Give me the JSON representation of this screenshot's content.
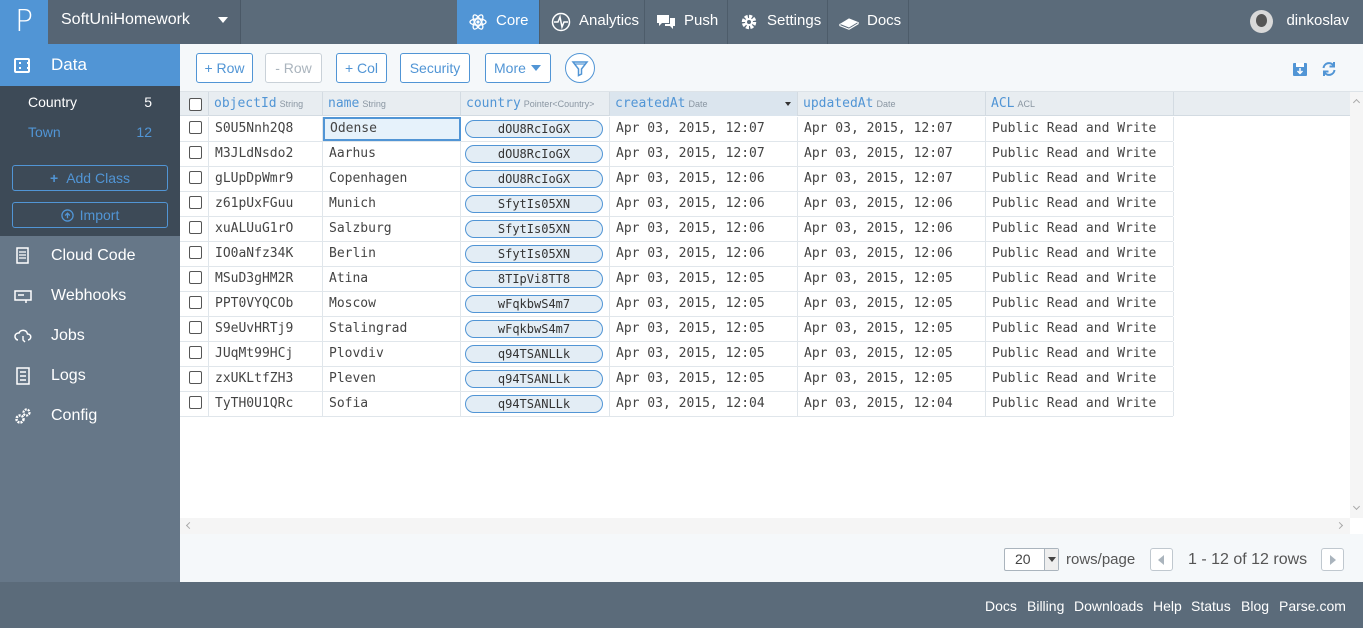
{
  "app": {
    "name": "SoftUniHomework",
    "logo": "P"
  },
  "nav": {
    "tabs": [
      {
        "label": "Core",
        "icon": "atom-icon",
        "active": true
      },
      {
        "label": "Analytics",
        "icon": "pulse-icon"
      },
      {
        "label": "Push",
        "icon": "chat-icon"
      },
      {
        "label": "Settings",
        "icon": "gear-icon"
      },
      {
        "label": "Docs",
        "icon": "book-icon"
      }
    ],
    "user": "dinkoslav"
  },
  "sidebar": {
    "data_label": "Data",
    "classes": [
      {
        "name": "Country",
        "count": "5"
      },
      {
        "name": "Town",
        "count": "12",
        "active": true
      }
    ],
    "add_class": "Add Class",
    "import": "Import",
    "links": [
      {
        "label": "Cloud Code",
        "icon": "document-icon"
      },
      {
        "label": "Webhooks",
        "icon": "webhook-icon"
      },
      {
        "label": "Jobs",
        "icon": "cloud-clock-icon"
      },
      {
        "label": "Logs",
        "icon": "log-icon"
      },
      {
        "label": "Config",
        "icon": "gears-icon"
      }
    ]
  },
  "toolbar": {
    "add_row": "+ Row",
    "remove_row": "- Row",
    "add_col": "+ Col",
    "security": "Security",
    "more": "More"
  },
  "table": {
    "columns": [
      {
        "name": "objectId",
        "type": "String"
      },
      {
        "name": "name",
        "type": "String"
      },
      {
        "name": "country",
        "type": "Pointer<Country>"
      },
      {
        "name": "createdAt",
        "type": "Date",
        "sorted": true
      },
      {
        "name": "updatedAt",
        "type": "Date"
      },
      {
        "name": "ACL",
        "type": "ACL"
      }
    ],
    "rows": [
      [
        "S0U5Nnh2Q8",
        "Odense",
        "dOU8RcIoGX",
        "Apr 03, 2015, 12:07",
        "Apr 03, 2015, 12:07",
        "Public Read and Write"
      ],
      [
        "M3JLdNsdo2",
        "Aarhus",
        "dOU8RcIoGX",
        "Apr 03, 2015, 12:07",
        "Apr 03, 2015, 12:07",
        "Public Read and Write"
      ],
      [
        "gLUpDpWmr9",
        "Copenhagen",
        "dOU8RcIoGX",
        "Apr 03, 2015, 12:06",
        "Apr 03, 2015, 12:07",
        "Public Read and Write"
      ],
      [
        "z61pUxFGuu",
        "Munich",
        "SfytIs05XN",
        "Apr 03, 2015, 12:06",
        "Apr 03, 2015, 12:06",
        "Public Read and Write"
      ],
      [
        "xuALUuG1rO",
        "Salzburg",
        "SfytIs05XN",
        "Apr 03, 2015, 12:06",
        "Apr 03, 2015, 12:06",
        "Public Read and Write"
      ],
      [
        "IO0aNfz34K",
        "Berlin",
        "SfytIs05XN",
        "Apr 03, 2015, 12:06",
        "Apr 03, 2015, 12:06",
        "Public Read and Write"
      ],
      [
        "MSuD3gHM2R",
        "Atina",
        "8TIpVi8TT8",
        "Apr 03, 2015, 12:05",
        "Apr 03, 2015, 12:05",
        "Public Read and Write"
      ],
      [
        "PPT0VYQCOb",
        "Moscow",
        "wFqkbwS4m7",
        "Apr 03, 2015, 12:05",
        "Apr 03, 2015, 12:05",
        "Public Read and Write"
      ],
      [
        "S9eUvHRTj9",
        "Stalingrad",
        "wFqkbwS4m7",
        "Apr 03, 2015, 12:05",
        "Apr 03, 2015, 12:05",
        "Public Read and Write"
      ],
      [
        "JUqMt99HCj",
        "Plovdiv",
        "q94TSANLLk",
        "Apr 03, 2015, 12:05",
        "Apr 03, 2015, 12:05",
        "Public Read and Write"
      ],
      [
        "zxUKLtfZH3",
        "Pleven",
        "q94TSANLLk",
        "Apr 03, 2015, 12:05",
        "Apr 03, 2015, 12:05",
        "Public Read and Write"
      ],
      [
        "TyTH0U1QRc",
        "Sofia",
        "q94TSANLLk",
        "Apr 03, 2015, 12:04",
        "Apr 03, 2015, 12:04",
        "Public Read and Write"
      ]
    ]
  },
  "pager": {
    "page_size": "20",
    "rows_per_page": "rows/page",
    "range": "1 - 12 of 12 rows"
  },
  "footer": {
    "links": [
      "Docs",
      "Billing",
      "Downloads",
      "Help",
      "Status",
      "Blog",
      "Parse.com"
    ]
  },
  "colors": {
    "accent": "#5195d5",
    "topbar": "#5b6b7a",
    "sidebar": "#667788",
    "sidebar_dark": "#3d4a57"
  }
}
